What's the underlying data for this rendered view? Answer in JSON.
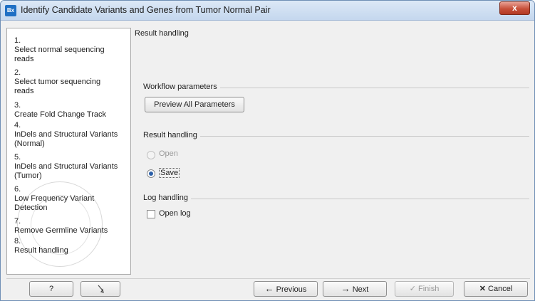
{
  "window": {
    "app_icon_text": "Bx",
    "title": "Identify Candidate Variants and Genes from Tumor Normal Pair",
    "close_label": "x"
  },
  "steps": [
    {
      "num": "1.",
      "label": "Select normal sequencing reads"
    },
    {
      "num": "2.",
      "label": "Select tumor sequencing reads"
    },
    {
      "num": "3.",
      "label": "Create Fold Change Track"
    },
    {
      "num": "4.",
      "label": "InDels and Structural Variants (Normal)"
    },
    {
      "num": "5.",
      "label": "InDels and Structural Variants (Tumor)"
    },
    {
      "num": "6.",
      "label": "Low Frequency Variant Detection"
    },
    {
      "num": "7.",
      "label": "Remove Germline Variants"
    },
    {
      "num": "8.",
      "label": "Result handling"
    }
  ],
  "main": {
    "header": "Result handling",
    "workflow_params": {
      "label": "Workflow parameters",
      "preview_button": "Preview All Parameters"
    },
    "result_handling": {
      "label": "Result handling",
      "open_label": "Open",
      "save_label": "Save",
      "selected": "Save"
    },
    "log_handling": {
      "label": "Log handling",
      "open_log_label": "Open log",
      "open_log_checked": false
    }
  },
  "footer": {
    "help_label": "?",
    "reset_icon": "undo-arrow-icon",
    "previous_label": "Previous",
    "next_label": "Next",
    "finish_label": "Finish",
    "cancel_label": "Cancel"
  }
}
